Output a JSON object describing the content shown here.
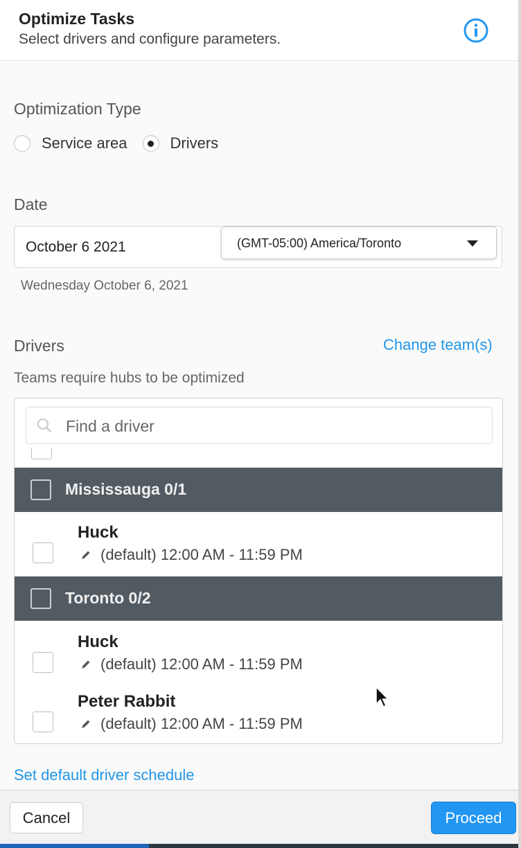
{
  "header": {
    "title": "Optimize Tasks",
    "subtitle": "Select drivers and configure parameters.",
    "info_icon": "info-icon",
    "accent_color": "#2196f3"
  },
  "optimization_type": {
    "label": "Optimization Type",
    "options": [
      {
        "label": "Service area",
        "selected": false
      },
      {
        "label": "Drivers",
        "selected": true
      }
    ]
  },
  "date": {
    "label": "Date",
    "value": "October 6 2021",
    "timezone": "(GMT-05:00) America/Toronto",
    "readable": "Wednesday October 6, 2021"
  },
  "drivers": {
    "label": "Drivers",
    "change_team_link": "Change team(s)",
    "hint": "Teams require hubs to be optimized",
    "search_placeholder": "Find a driver",
    "groups": [
      {
        "label": "Mississauga 0/1",
        "drivers": [
          {
            "name": "Huck",
            "schedule": "(default) 12:00 AM - 11:59 PM"
          }
        ]
      },
      {
        "label": "Toronto 0/2",
        "drivers": [
          {
            "name": "Huck",
            "schedule": "(default) 12:00 AM - 11:59 PM"
          },
          {
            "name": "Peter Rabbit",
            "schedule": "(default) 12:00 AM - 11:59 PM"
          }
        ]
      }
    ],
    "default_schedule_link": "Set default driver schedule"
  },
  "footer": {
    "cancel_label": "Cancel",
    "proceed_label": "Proceed"
  }
}
